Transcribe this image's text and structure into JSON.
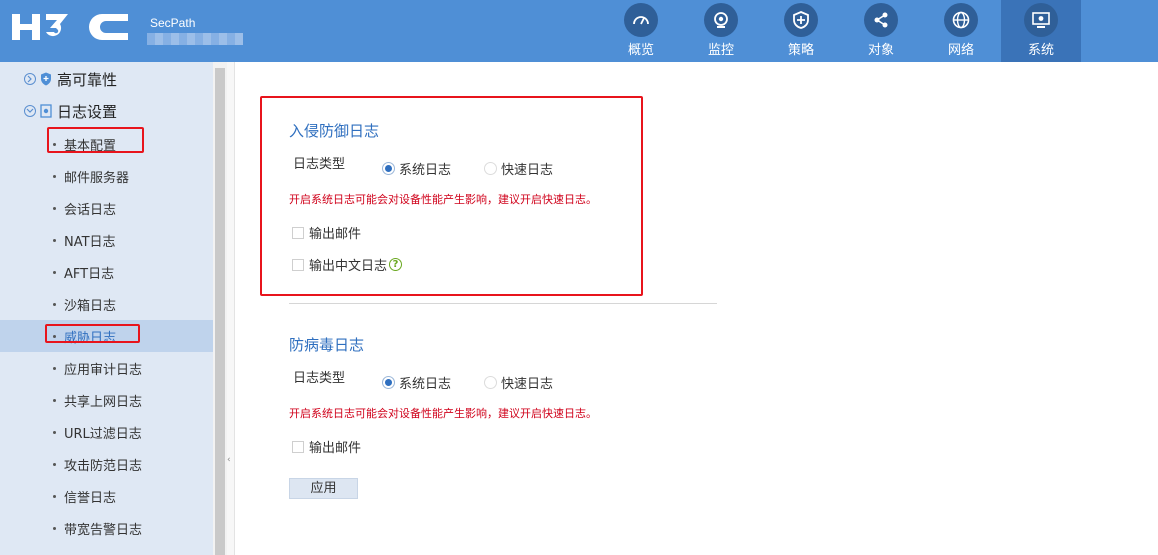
{
  "header": {
    "brand": "H3C",
    "product": "SecPath",
    "nav": [
      {
        "label": "概览",
        "icon": "gauge-icon"
      },
      {
        "label": "监控",
        "icon": "camera-icon"
      },
      {
        "label": "策略",
        "icon": "shield-icon"
      },
      {
        "label": "对象",
        "icon": "share-icon"
      },
      {
        "label": "网络",
        "icon": "globe-icon"
      },
      {
        "label": "系统",
        "icon": "monitor-gear-icon",
        "active": true
      }
    ]
  },
  "sidebar": {
    "groups": [
      {
        "label": "高可靠性",
        "icon": "shield-icon"
      },
      {
        "label": "日志设置",
        "icon": "log-settings-icon"
      }
    ],
    "items": [
      {
        "label": "基本配置"
      },
      {
        "label": "邮件服务器"
      },
      {
        "label": "会话日志"
      },
      {
        "label": "NAT日志"
      },
      {
        "label": "AFT日志"
      },
      {
        "label": "沙箱日志"
      },
      {
        "label": "威胁日志",
        "active": true
      },
      {
        "label": "应用审计日志"
      },
      {
        "label": "共享上网日志"
      },
      {
        "label": "URL过滤日志"
      },
      {
        "label": "攻击防范日志"
      },
      {
        "label": "信誉日志"
      },
      {
        "label": "带宽告警日志"
      }
    ]
  },
  "ips": {
    "title": "入侵防御日志",
    "type_label": "日志类型",
    "radio_system": "系统日志",
    "radio_fast": "快速日志",
    "selected": "系统日志",
    "warning": "开启系统日志可能会对设备性能产生影响，建议开启快速日志。",
    "check_mail": "输出邮件",
    "check_chinese": "输出中文日志",
    "help_glyph": "?"
  },
  "av": {
    "title": "防病毒日志",
    "type_label": "日志类型",
    "radio_system": "系统日志",
    "radio_fast": "快速日志",
    "selected": "系统日志",
    "warning": "开启系统日志可能会对设备性能产生影响，建议开启快速日志。",
    "check_mail": "输出邮件"
  },
  "apply_label": "应用",
  "colors": {
    "header_bg": "#4f8fd6",
    "active_nav": "#3a73b8",
    "accent": "#2f6fbf",
    "warning": "#d0021b",
    "highlight": "#e8141c"
  }
}
